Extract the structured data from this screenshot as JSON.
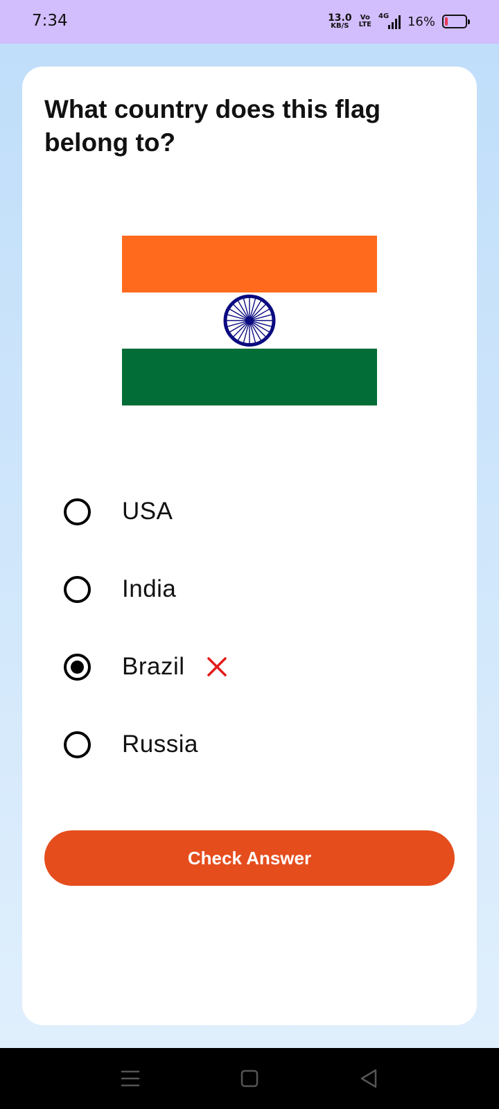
{
  "status_bar": {
    "time": "7:34",
    "net_speed_value": "13.0",
    "net_speed_unit": "KB/S",
    "volte_top": "Vo",
    "volte_bottom": "LTE",
    "network": "4G",
    "battery_percent": "16%",
    "battery_level": 0.16
  },
  "quiz": {
    "question": "What country does this flag belong to?",
    "flag_icon": "india-flag-icon",
    "options": [
      {
        "label": "USA",
        "selected": false
      },
      {
        "label": "India",
        "selected": false
      },
      {
        "label": "Brazil",
        "selected": true,
        "feedback": "wrong"
      },
      {
        "label": "Russia",
        "selected": false
      }
    ],
    "check_button_label": "Check Answer"
  },
  "colors": {
    "accent_button": "#e54d1d",
    "wrong_mark": "#e31b1b",
    "status_bar": "#d2bdfd",
    "flag_saffron": "#ff6a1c",
    "flag_green": "#026d36",
    "flag_chakra": "#0a0a80"
  },
  "nav_bar": {
    "icons": [
      "menu-icon",
      "home-icon",
      "back-icon"
    ]
  }
}
